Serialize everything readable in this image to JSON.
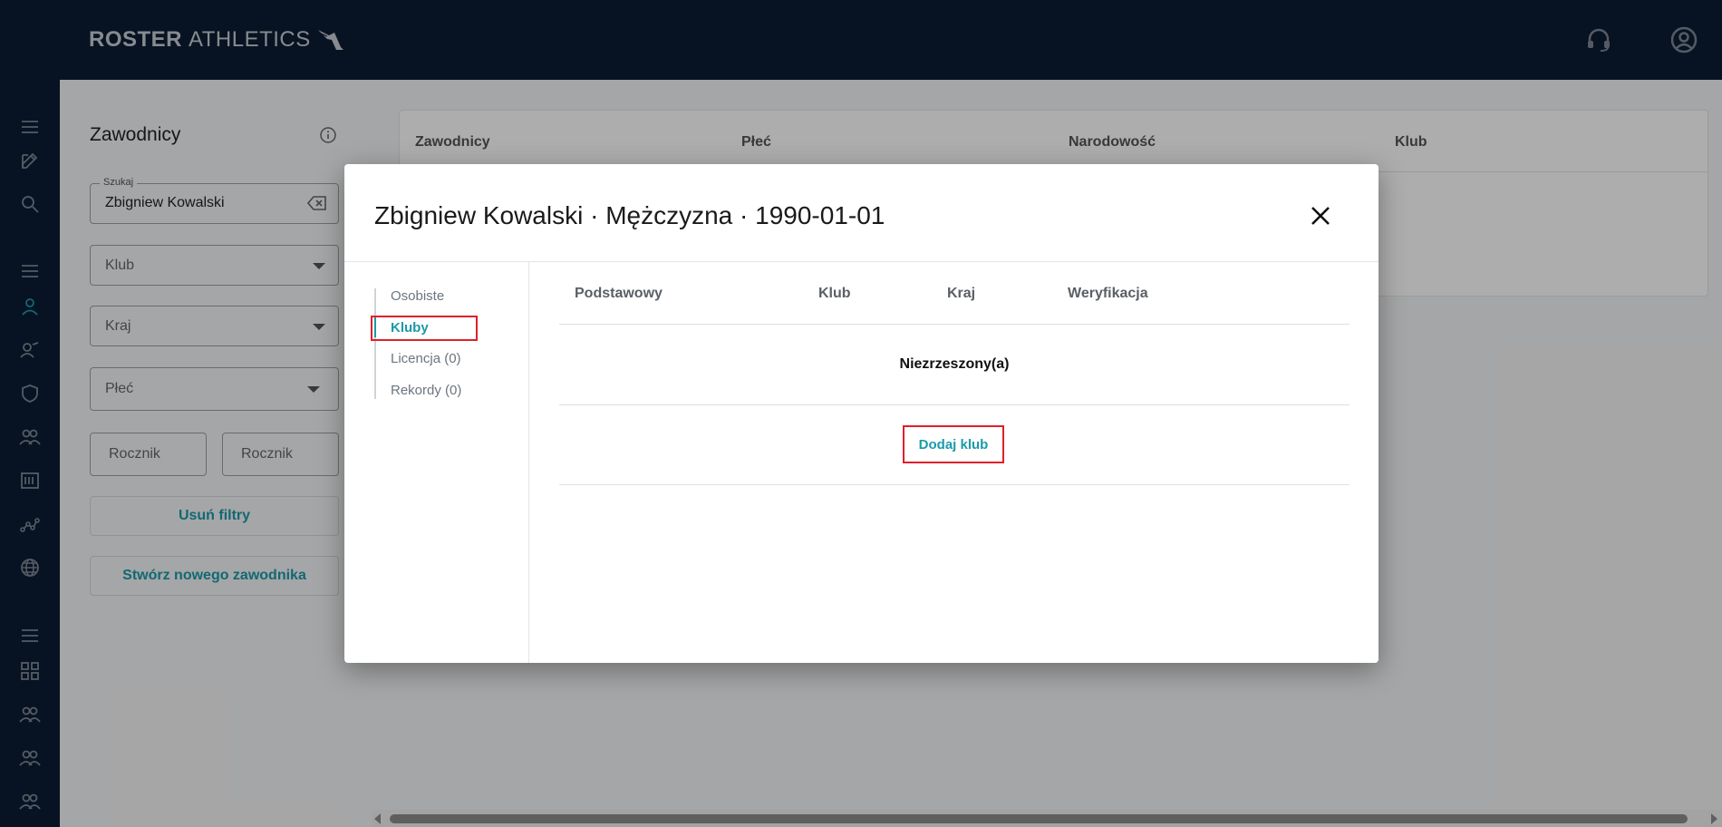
{
  "brand": {
    "name_bold": "ROSTER",
    "name_light": "ATHLETICS"
  },
  "header": {
    "icons": [
      "headset-icon",
      "account-circle-icon"
    ]
  },
  "sidebar": {
    "icons": [
      "menu-icon",
      "edit-icon",
      "search-icon",
      "menu-icon",
      "person-icon",
      "coach-icon",
      "shield-icon",
      "group-icon",
      "license-icon",
      "timeline-icon",
      "globe-icon",
      "menu-icon",
      "apps-icon",
      "group-icon",
      "group-icon",
      "group-icon"
    ]
  },
  "filters": {
    "title": "Zawodnicy",
    "search_legend": "Szukaj",
    "search_value": "Zbigniew Kowalski",
    "club_placeholder": "Klub",
    "country_placeholder": "Kraj",
    "gender_placeholder": "Płeć",
    "year_from_placeholder": "Rocznik",
    "year_to_placeholder": "Rocznik",
    "clear_label": "Usuń filtry",
    "create_label": "Stwórz nowego zawodnika"
  },
  "background_table": {
    "columns": [
      "Zawodnicy",
      "Płeć",
      "Narodowość",
      "Klub"
    ]
  },
  "modal": {
    "title": "Zbigniew Kowalski · Mężczyzna · 1990-01-01",
    "nav": [
      "Osobiste",
      "Kluby",
      "Licencja (0)",
      "Rekordy (0)"
    ],
    "active_nav": "Kluby",
    "table_columns": [
      "Podstawowy",
      "Klub",
      "Kraj",
      "Weryfikacja"
    ],
    "empty_message": "Niezrzeszony(a)",
    "add_club_label": "Dodaj klub"
  },
  "colors": {
    "topbar": "#0b1d33",
    "accent": "#1b9aaa",
    "highlight": "#e0202a"
  }
}
